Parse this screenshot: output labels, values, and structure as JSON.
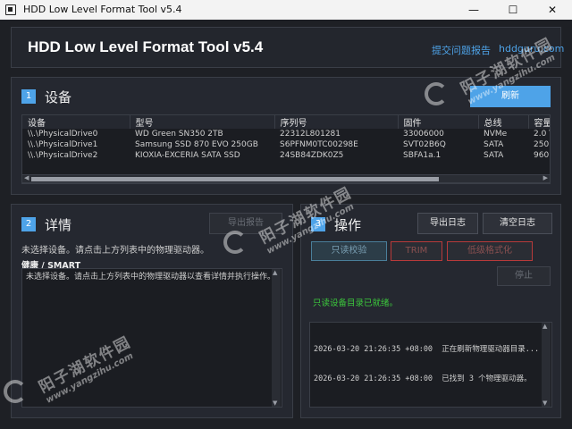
{
  "window": {
    "title": "HDD Low Level Format Tool v5.4",
    "minimize": "—",
    "maximize": "☐",
    "close": "✕"
  },
  "header": {
    "app_title": "HDD Low Level Format Tool v5.4",
    "link_feedback": "提交问题报告",
    "link_site": "hddguru.com"
  },
  "devices": {
    "number": "1",
    "title": "设备",
    "refresh_label": "刷新",
    "columns": [
      "设备",
      "型号",
      "序列号",
      "固件",
      "总线",
      "容量"
    ],
    "rows": [
      [
        "\\\\.\\PhysicalDrive0",
        "WD Green SN350 2TB",
        "22312L801281",
        "33006000",
        "NVMe",
        "2.0 T"
      ],
      [
        "\\\\.\\PhysicalDrive1",
        "Samsung SSD 870 EVO 250GB",
        "S6PFNM0TC00298E",
        "SVT02B6Q",
        "SATA",
        "250."
      ],
      [
        "\\\\.\\PhysicalDrive2",
        "KIOXIA-EXCERIA SATA SSD",
        "24SB84ZDK0Z5",
        "SBFA1a.1",
        "SATA",
        "960."
      ]
    ]
  },
  "details": {
    "number": "2",
    "title": "详情",
    "export_label": "导出报告",
    "no_selection": "未选择设备。请点击上方列表中的物理驱动器。",
    "health_label": "健康 / SMART",
    "health_text": "未选择设备。请点击上方列表中的物理驱动器以查看详情并执行操作。"
  },
  "operations": {
    "number": "3",
    "title": "操作",
    "export_log_label": "导出日志",
    "clear_log_label": "清空日志",
    "readonly_label": "只读校验",
    "trim_label": "TRIM",
    "lowformat_label": "低级格式化",
    "stop_label": "停止",
    "status": "只读设备目录已就绪。",
    "log": [
      "2026-03-20 21:26:35 +08:00  正在刷新物理驱动器目录...",
      "2026-03-20 21:26:35 +08:00  已找到 3 个物理驱动器。"
    ]
  },
  "watermark": {
    "text": "阳子湖软件园",
    "url": "www.yangzihu.com"
  },
  "colors": {
    "accent": "#4ea3e8",
    "danger": "#b83a3a",
    "ok": "#3cc83c"
  }
}
